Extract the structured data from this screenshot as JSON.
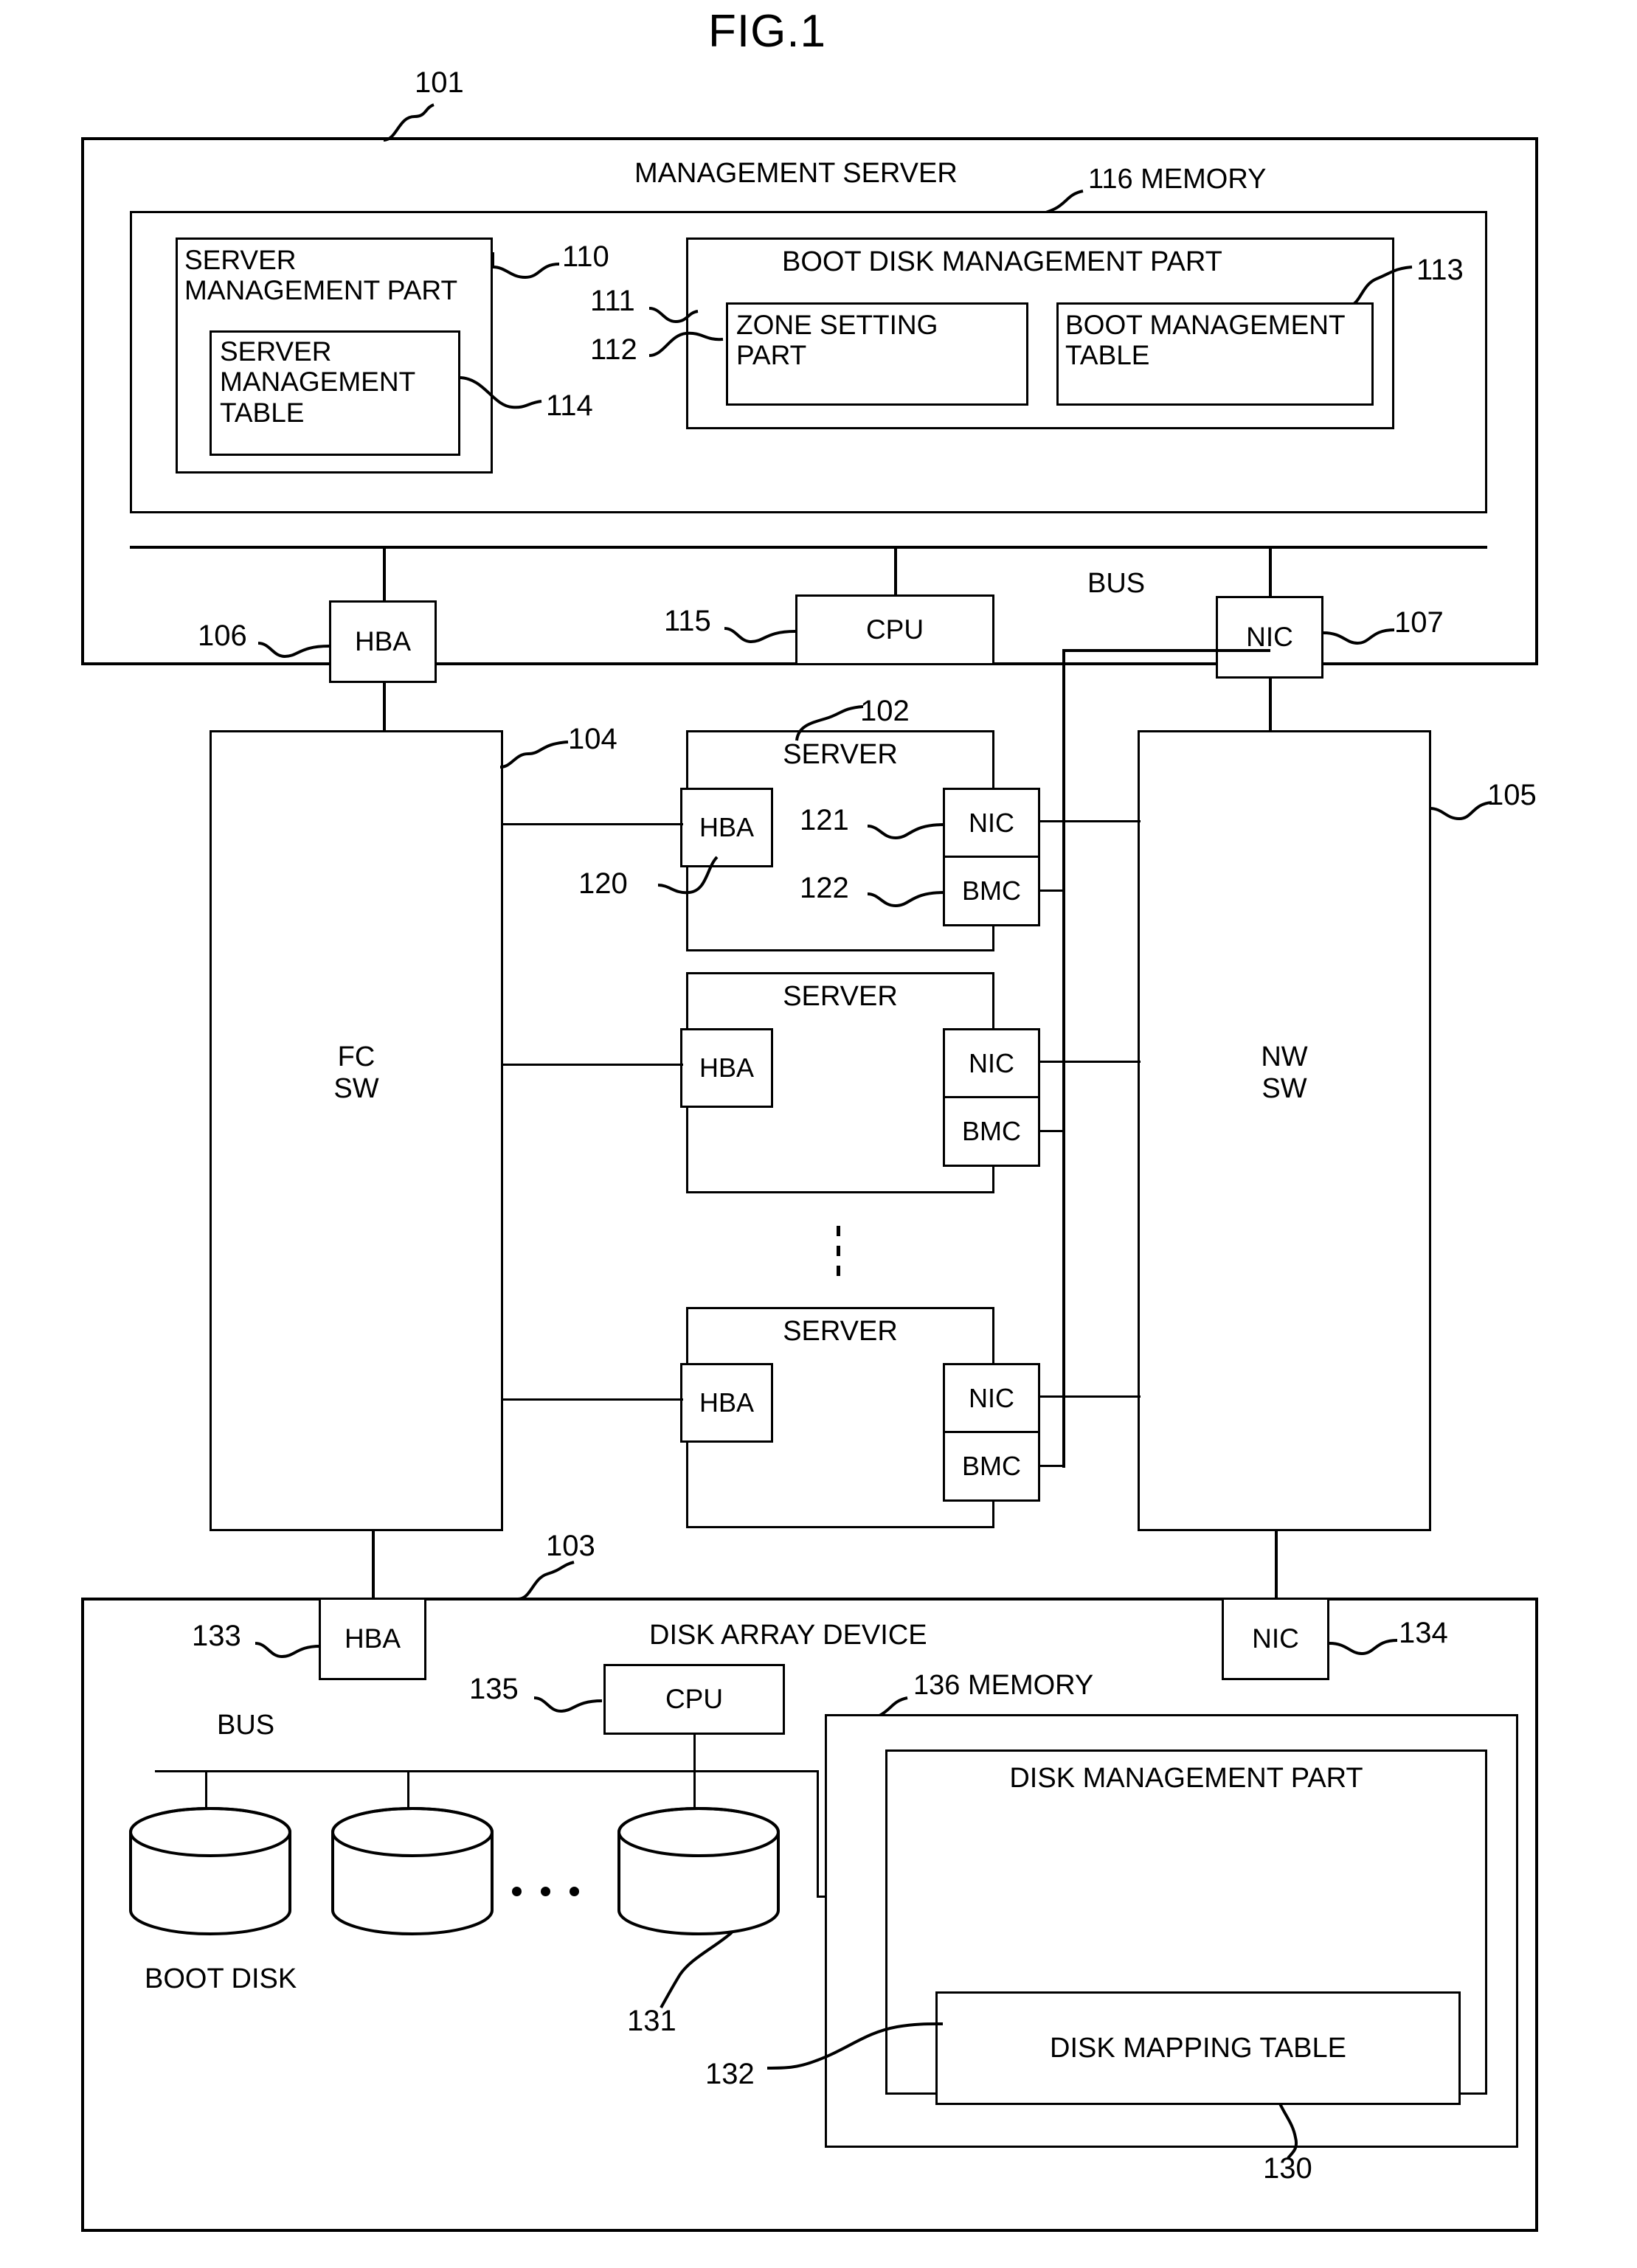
{
  "figure": {
    "title": "FIG.1"
  },
  "management_server": {
    "ref": "101",
    "title": "MANAGEMENT SERVER",
    "memory": {
      "ref_label": "116 MEMORY"
    },
    "server_management_part": {
      "ref": "110",
      "label": "SERVER\nMANAGEMENT PART",
      "table": {
        "ref": "114",
        "label": "SERVER\nMANAGEMENT\nTABLE"
      }
    },
    "boot_disk_management_part": {
      "ref": "113",
      "label": "BOOT DISK MANAGEMENT PART",
      "zone_setting_part": {
        "ref": "112",
        "label": "ZONE SETTING\nPART"
      },
      "boot_management_table": {
        "ref": "111",
        "label": "BOOT MANAGEMENT\nTABLE"
      }
    },
    "hba": {
      "ref": "106",
      "label": "HBA"
    },
    "cpu": {
      "ref": "115",
      "label": "CPU"
    },
    "bus": {
      "label": "BUS"
    },
    "nic": {
      "ref": "107",
      "label": "NIC"
    }
  },
  "fc_switch": {
    "ref": "104",
    "label": "FC\nSW"
  },
  "nw_switch": {
    "ref": "105",
    "label": "NW\nSW"
  },
  "servers": [
    {
      "ref": "102",
      "label": "SERVER",
      "hba": {
        "ref": "120",
        "label": "HBA"
      },
      "nic": {
        "ref": "121",
        "label": "NIC"
      },
      "bmc": {
        "ref": "122",
        "label": "BMC"
      }
    },
    {
      "ref": "",
      "label": "SERVER",
      "hba": {
        "ref": "",
        "label": "HBA"
      },
      "nic": {
        "ref": "",
        "label": "NIC"
      },
      "bmc": {
        "ref": "",
        "label": "BMC"
      }
    },
    {
      "ref": "",
      "label": "SERVER",
      "hba": {
        "ref": "",
        "label": "HBA"
      },
      "nic": {
        "ref": "",
        "label": "NIC"
      },
      "bmc": {
        "ref": "",
        "label": "BMC"
      }
    }
  ],
  "disk_array_device": {
    "ref": "103",
    "title": "DISK ARRAY DEVICE",
    "hba": {
      "ref": "133",
      "label": "HBA"
    },
    "nic": {
      "ref": "134",
      "label": "NIC"
    },
    "cpu": {
      "ref": "135",
      "label": "CPU"
    },
    "bus": {
      "label": "BUS"
    },
    "memory": {
      "ref_label": "136 MEMORY"
    },
    "boot_disk": {
      "ref": "131",
      "label": "BOOT DISK"
    },
    "disk_management_part": {
      "ref": "130",
      "label": "DISK MANAGEMENT PART",
      "disk_mapping_table": {
        "ref": "132",
        "label": "DISK MAPPING TABLE"
      }
    }
  }
}
